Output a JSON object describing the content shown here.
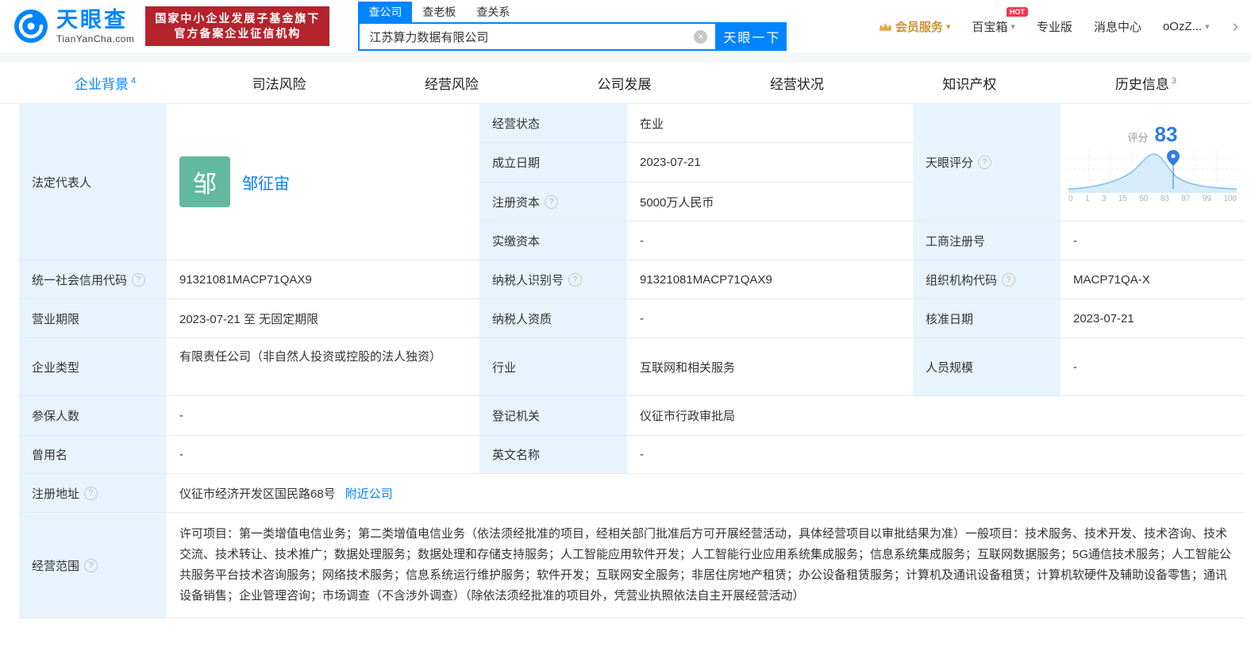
{
  "colors": {
    "accent": "#0084ff",
    "badge_red": "#b5232d",
    "avatar_green": "#63b8a0",
    "score_blue": "#2f7ce8",
    "hot_red": "#f3364d",
    "vip_orange": "#cf9236",
    "label_bg": "#e8f4fd"
  },
  "icons": {
    "help": "?",
    "caret": "▾",
    "clear": "×",
    "more": "›"
  },
  "header": {
    "logo": {
      "brand": "天眼查",
      "domain": "TianYanCha.com"
    },
    "badge": {
      "line1": "国家中小企业发展子基金旗下",
      "line2": "官方备案企业征信机构"
    },
    "search": {
      "tabs": [
        {
          "label": "查公司",
          "active": true
        },
        {
          "label": "查老板",
          "active": false
        },
        {
          "label": "查关系",
          "active": false
        }
      ],
      "value": "江苏算力数据有限公司",
      "button": "天眼一下"
    },
    "nav": {
      "vip": "会员服务",
      "toolbox": "百宝箱",
      "toolbox_badge": "HOT",
      "pro": "专业版",
      "messages": "消息中心",
      "user": "oOzZ..."
    }
  },
  "tabs": [
    {
      "label": "企业背景",
      "count": "4",
      "active": true
    },
    {
      "label": "司法风险",
      "count": "",
      "active": false
    },
    {
      "label": "经营风险",
      "count": "",
      "active": false
    },
    {
      "label": "公司发展",
      "count": "",
      "active": false
    },
    {
      "label": "经营状况",
      "count": "",
      "active": false
    },
    {
      "label": "知识产权",
      "count": "",
      "active": false
    },
    {
      "label": "历史信息",
      "count": "3",
      "active": false
    }
  ],
  "profile": {
    "legal_rep": {
      "label": "法定代表人",
      "avatar": "邹",
      "name": "邹征宙"
    },
    "status": {
      "label": "经营状态",
      "value": "在业"
    },
    "established": {
      "label": "成立日期",
      "value": "2023-07-21"
    },
    "reg_capital": {
      "label": "注册资本",
      "value": "5000万人民币"
    },
    "paid_capital": {
      "label": "实缴资本",
      "value": "-"
    },
    "score": {
      "label": "天眼评分",
      "prefix": "评分",
      "value": "83",
      "axis": [
        "0",
        "1",
        "3",
        "15",
        "50",
        "83",
        "97",
        "99",
        "100"
      ]
    },
    "reg_number": {
      "label": "工商注册号",
      "value": "-"
    },
    "credit_code": {
      "label": "统一社会信用代码",
      "value": "91321081MACP71QAX9"
    },
    "taxpayer_id": {
      "label": "纳税人识别号",
      "value": "91321081MACP71QAX9"
    },
    "org_code": {
      "label": "组织机构代码",
      "value": "MACP71QA-X"
    },
    "term": {
      "label": "营业期限",
      "value": "2023-07-21 至 无固定期限"
    },
    "taxpayer_quality": {
      "label": "纳税人资质",
      "value": "-"
    },
    "approval_date": {
      "label": "核准日期",
      "value": "2023-07-21"
    },
    "company_type": {
      "label": "企业类型",
      "value": "有限责任公司（非自然人投资或控股的法人独资）"
    },
    "industry": {
      "label": "行业",
      "value": "互联网和相关服务"
    },
    "staff_size": {
      "label": "人员规模",
      "value": "-"
    },
    "insured": {
      "label": "参保人数",
      "value": "-"
    },
    "registry": {
      "label": "登记机关",
      "value": "仪征市行政审批局"
    },
    "former_name": {
      "label": "曾用名",
      "value": "-"
    },
    "english_name": {
      "label": "英文名称",
      "value": "-"
    },
    "address": {
      "label": "注册地址",
      "value": "仪征市经济开发区国民路68号",
      "link": "附近公司"
    },
    "scope": {
      "label": "经营范围",
      "value": "许可项目：第一类增值电信业务；第二类增值电信业务（依法须经批准的项目，经相关部门批准后方可开展经营活动，具体经营项目以审批结果为准）一般项目：技术服务、技术开发、技术咨询、技术交流、技术转让、技术推广；数据处理服务；数据处理和存储支持服务；人工智能应用软件开发；人工智能行业应用系统集成服务；信息系统集成服务；互联网数据服务；5G通信技术服务；人工智能公共服务平台技术咨询服务；网络技术服务；信息系统运行维护服务；软件开发；互联网安全服务；非居住房地产租赁；办公设备租赁服务；计算机及通讯设备租赁；计算机软硬件及辅助设备零售；通讯设备销售；企业管理咨询；市场调查（不含涉外调查）（除依法须经批准的项目外，凭营业执照依法自主开展经营活动）"
    }
  }
}
